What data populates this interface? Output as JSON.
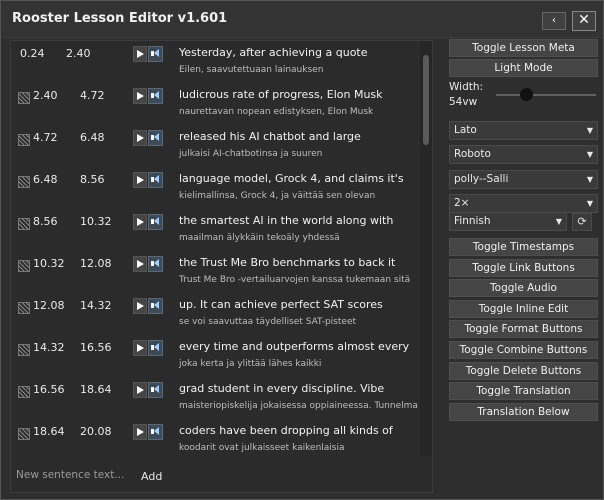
{
  "window": {
    "title": "Rooster Lesson Editor v1.601",
    "back_icon": "chevron-left-icon",
    "back_glyph": "‹",
    "close_icon": "close-icon",
    "close_glyph": "✕"
  },
  "rows": [
    {
      "start": "0.24",
      "end": "2.40",
      "sentence": "Yesterday, after achieving a quote",
      "translation": "Eilen, saavutettuaan lainauksen"
    },
    {
      "start": "2.40",
      "end": "4.72",
      "sentence": "ludicrous rate of progress, Elon Musk",
      "translation": "naurettavan nopean edistyksen, Elon Musk"
    },
    {
      "start": "4.72",
      "end": "6.48",
      "sentence": "released his AI chatbot and large",
      "translation": "julkaisi AI-chatbotinsa ja suuren"
    },
    {
      "start": "6.48",
      "end": "8.56",
      "sentence": "language model, Grock 4, and claims it's",
      "translation": "kielimallinsa, Grock 4, ja väittää sen olevan"
    },
    {
      "start": "8.56",
      "end": "10.32",
      "sentence": "the smartest AI in the world along with",
      "translation": "maailman älykkäin tekoäly yhdessä"
    },
    {
      "start": "10.32",
      "end": "12.08",
      "sentence": "the Trust Me Bro benchmarks to back it",
      "translation": "Trust Me Bro -vertailuarvojen kanssa tukemaan sitä"
    },
    {
      "start": "12.08",
      "end": "14.32",
      "sentence": "up. It can achieve perfect SAT scores",
      "translation": "se voi saavuttaa täydelliset SAT-pisteet"
    },
    {
      "start": "14.32",
      "end": "16.56",
      "sentence": "every time and outperforms almost every",
      "translation": "joka kerta ja ylittää lähes kaikki"
    },
    {
      "start": "16.56",
      "end": "18.64",
      "sentence": "grad student in every discipline. Vibe",
      "translation": "maisteriopiskelija jokaisessa oppiaineessa. Tunnelma"
    },
    {
      "start": "18.64",
      "end": "20.08",
      "sentence": "coders have been dropping all kinds of",
      "translation": "koodarit ovat julkaisseet kaikenlaisia"
    }
  ],
  "new_sentence": {
    "placeholder": "New sentence text...",
    "add_label": "Add"
  },
  "side": {
    "toggle_lesson_meta": "Toggle Lesson Meta",
    "light_mode": "Light Mode",
    "width_label": "Width:",
    "width_value": "54vw",
    "width_level_fraction": 0.3,
    "font1": "Lato",
    "font2": "Roboto",
    "voice": "polly--Salli",
    "speed": "2×",
    "language": "Finnish",
    "refresh_glyph": "⟳",
    "buttons": [
      "Toggle Timestamps",
      "Toggle Link Buttons",
      "Toggle Audio",
      "Toggle Inline Edit",
      "Toggle Format Buttons",
      "Toggle Combine Buttons",
      "Toggle Delete Buttons",
      "Toggle Translation",
      "Translation Below"
    ]
  },
  "colors": {
    "background": "#2b2b2b",
    "button": "#454545",
    "text": "#f0f0f0"
  }
}
